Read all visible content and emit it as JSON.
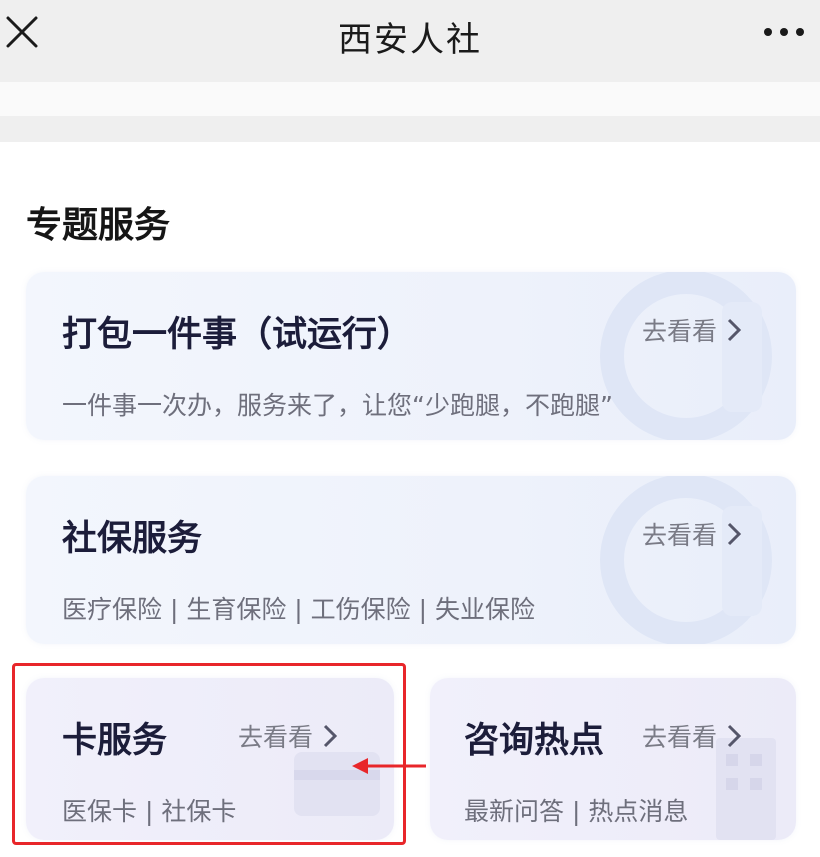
{
  "header": {
    "title": "西安人社",
    "close_icon": "close-icon",
    "more_icon": "more-icon"
  },
  "section": {
    "title": "专题服务"
  },
  "cards": [
    {
      "title": "打包一件事（试运行）",
      "link": "去看看",
      "subtitle": "一件事一次办，服务来了，让您“少跑腿，不跑腿”"
    },
    {
      "title": "社保服务",
      "link": "去看看",
      "subtitle": "医疗保险 | 生育保险 | 工伤保险 | 失业保险"
    },
    {
      "title": "卡服务",
      "link": "去看看",
      "subtitle": "医保卡 | 社保卡",
      "highlighted": true
    },
    {
      "title": "咨询热点",
      "link": "去看看",
      "subtitle": "最新问答 | 热点消息"
    }
  ],
  "annotation": {
    "highlight_color": "#e8262a",
    "arrow": "arrow-left-icon"
  }
}
